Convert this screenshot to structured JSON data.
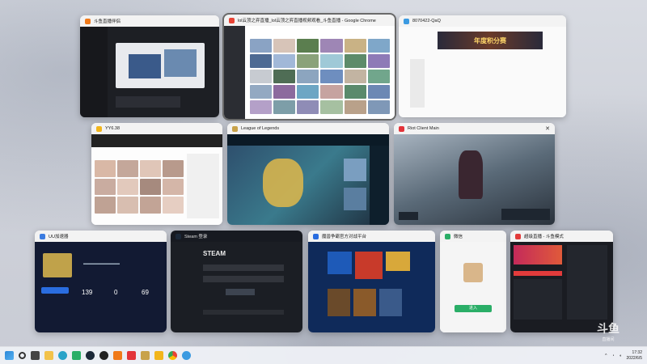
{
  "windows": [
    {
      "id": "douyu-client",
      "title": "斗鱼直播伴侣",
      "icon_color": "#f07a1a"
    },
    {
      "id": "chrome",
      "title": "lol云顶之弈直播_lol云顶之弈直播视频观看_斗鱼直播 - Google Chrome",
      "icon_color": "#e84335"
    },
    {
      "id": "qq",
      "title": "8070422-QaQ",
      "icon_color": "#3b9ae1"
    },
    {
      "id": "yy",
      "title": "YY6.38",
      "icon_color": "#f2b51c"
    },
    {
      "id": "lol",
      "title": "League of Legends",
      "icon_color": "#c8a24a"
    },
    {
      "id": "riot",
      "title": "Riot Client Main",
      "icon_color": "#e3343a"
    },
    {
      "id": "uu",
      "title": "UU加速器",
      "icon_color": "#3a7be0"
    },
    {
      "id": "steam",
      "title": "Steam 登录",
      "icon_color": "#1b2838"
    },
    {
      "id": "wegame",
      "title": "魔兽争霸官方对战平台",
      "icon_color": "#2a6de0"
    },
    {
      "id": "wechat",
      "title": "微信",
      "icon_color": "#2aae67"
    },
    {
      "id": "obs",
      "title": "超级直播 - 斗鱼模式",
      "icon_color": "#e23b3b"
    }
  ],
  "uu": {
    "stat1": "139",
    "stat2": "0",
    "stat3": "69"
  },
  "steam": {
    "logo": "STEAM",
    "login": "登录"
  },
  "wechat": {
    "login_btn": "进入"
  },
  "qq_banner": "年度积分赛",
  "taskbar": {
    "icons": [
      "windows-start-icon",
      "search-icon",
      "task-view-icon",
      "explorer-icon",
      "edge-icon",
      "wechat-icon",
      "steam-icon",
      "obs-icon",
      "douyu-icon",
      "riot-icon",
      "lol-icon",
      "yy-icon",
      "chrome-icon",
      "qq-icon"
    ],
    "time": "17:32",
    "date": "2022/6/5"
  },
  "watermark": {
    "top": "斗鱼",
    "bottom": "直播间"
  }
}
